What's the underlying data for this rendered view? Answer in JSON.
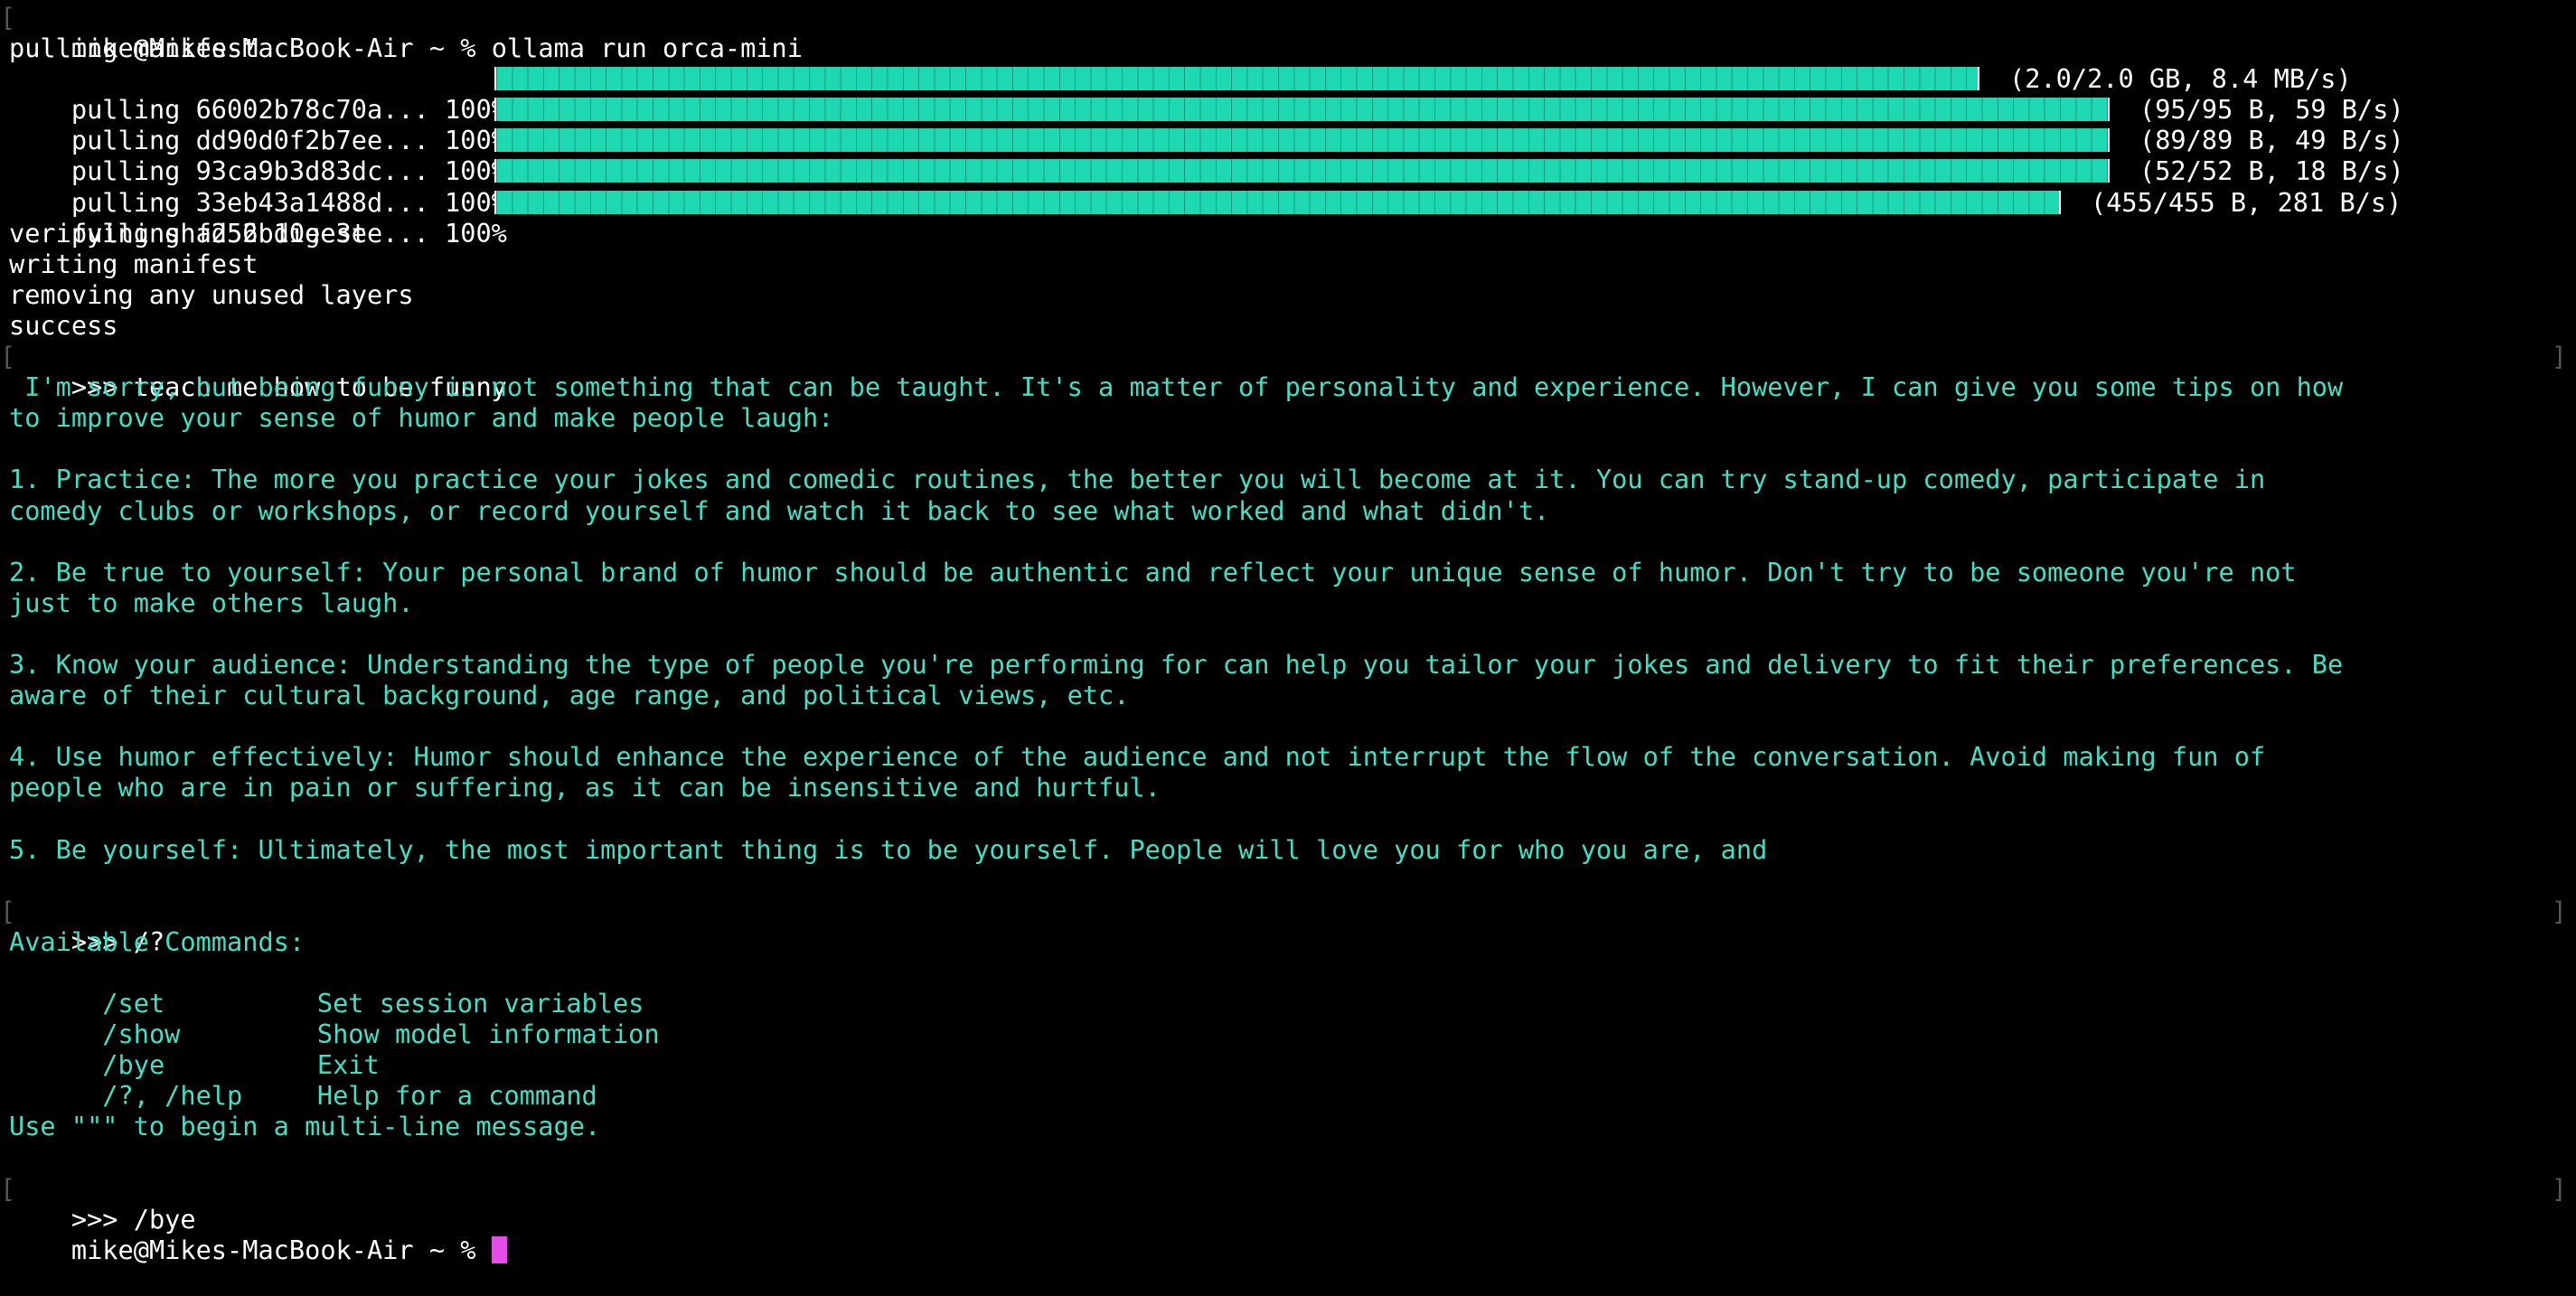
{
  "session": {
    "prompt": "mike@Mikes-MacBook-Air ~ % ",
    "command": "ollama run orca-mini"
  },
  "pull": {
    "manifest_line": "pulling manifest",
    "layers": [
      {
        "label": "pulling 66002b78c70a... 100%",
        "progress": 1.0,
        "stats": "(2.0/2.0 GB, 8.4 MB/s)"
      },
      {
        "label": "pulling dd90d0f2b7ee... 100%",
        "progress": 1.0,
        "stats": "(95/95 B, 59 B/s)"
      },
      {
        "label": "pulling 93ca9b3d83dc... 100%",
        "progress": 1.0,
        "stats": "(89/89 B, 49 B/s)"
      },
      {
        "label": "pulling 33eb43a1488d... 100%",
        "progress": 1.0,
        "stats": "(52/52 B, 18 B/s)"
      },
      {
        "label": "pulling fd52b10ee3ee... 100%",
        "progress": 1.0,
        "stats": "(455/455 B, 281 B/s)"
      }
    ],
    "after": [
      "verifying sha256 digest",
      "writing manifest",
      "removing any unused layers",
      "success"
    ]
  },
  "chat": {
    "user_prompt_1": ">>> teach me how to be funny",
    "response_lines": [
      " I'm sorry, but being funny is not something that can be taught. It's a matter of personality and experience. However, I can give you some tips on how",
      "to improve your sense of humor and make people laugh:",
      "",
      "1. Practice: The more you practice your jokes and comedic routines, the better you will become at it. You can try stand-up comedy, participate in",
      "comedy clubs or workshops, or record yourself and watch it back to see what worked and what didn't.",
      "",
      "2. Be true to yourself: Your personal brand of humor should be authentic and reflect your unique sense of humor. Don't try to be someone you're not",
      "just to make others laugh.",
      "",
      "3. Know your audience: Understanding the type of people you're performing for can help you tailor your jokes and delivery to fit their preferences. Be",
      "aware of their cultural background, age range, and political views, etc.",
      "",
      "4. Use humor effectively: Humor should enhance the experience of the audience and not interrupt the flow of the conversation. Avoid making fun of",
      "people who are in pain or suffering, as it can be insensitive and hurtful.",
      "",
      "5. Be yourself: Ultimately, the most important thing is to be yourself. People will love you for who you are, and",
      ""
    ],
    "user_prompt_2": ">>> /?",
    "help_title": "Available Commands:",
    "commands": [
      {
        "cmd": "  /set",
        "desc": "Set session variables"
      },
      {
        "cmd": "  /show",
        "desc": "Show model information"
      },
      {
        "cmd": "  /bye",
        "desc": "Exit"
      },
      {
        "cmd": "  /?, /help",
        "desc": "Help for a command"
      }
    ],
    "multiline_hint": "Use \"\"\" to begin a multi-line message.",
    "user_prompt_3": ">>> /bye"
  },
  "final_prompt": "mike@Mikes-MacBook-Air ~ % ",
  "colors": {
    "background": "#000000",
    "text": "#41e0c4",
    "prompt_text": "#ffffff",
    "progress_bar": "#1ed8b2",
    "cursor": "#e44ce8"
  }
}
